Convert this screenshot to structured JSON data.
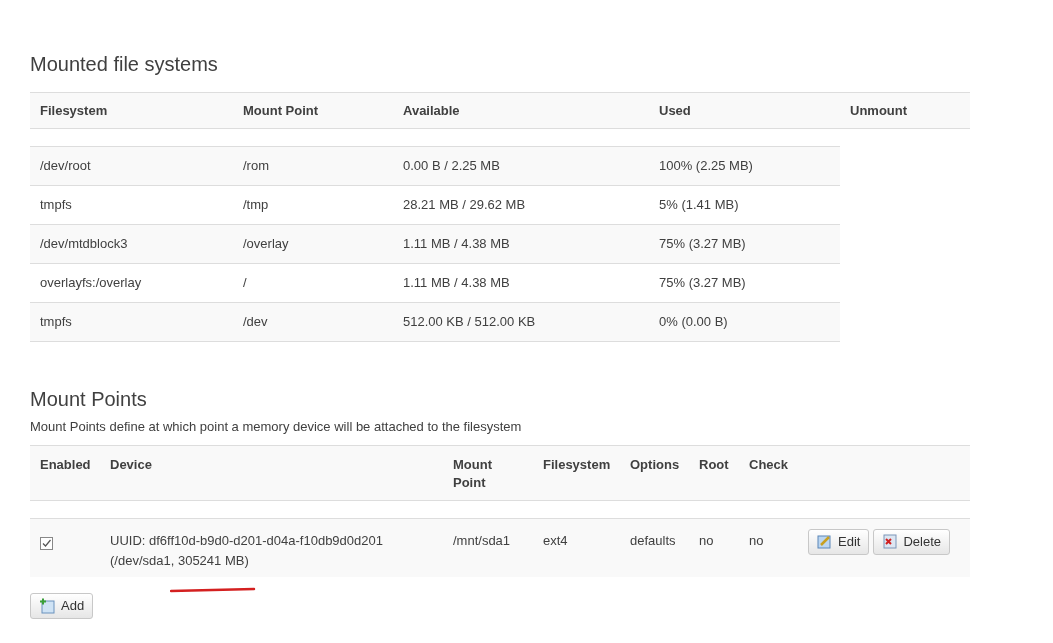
{
  "mounted": {
    "title": "Mounted file systems",
    "columns": [
      "Filesystem",
      "Mount Point",
      "Available",
      "Used",
      "Unmount"
    ],
    "rows": [
      {
        "filesystem": "/dev/root",
        "mount_point": "/rom",
        "available": "0.00 B / 2.25 MB",
        "used": "100% (2.25 MB)"
      },
      {
        "filesystem": "tmpfs",
        "mount_point": "/tmp",
        "available": "28.21 MB / 29.62 MB",
        "used": "5% (1.41 MB)"
      },
      {
        "filesystem": "/dev/mtdblock3",
        "mount_point": "/overlay",
        "available": "1.11 MB / 4.38 MB",
        "used": "75% (3.27 MB)"
      },
      {
        "filesystem": "overlayfs:/overlay",
        "mount_point": "/",
        "available": "1.11 MB / 4.38 MB",
        "used": "75% (3.27 MB)"
      },
      {
        "filesystem": "tmpfs",
        "mount_point": "/dev",
        "available": "512.00 KB / 512.00 KB",
        "used": "0% (0.00 B)"
      }
    ]
  },
  "mount_points": {
    "title": "Mount Points",
    "description": "Mount Points define at which point a memory device will be attached to the filesystem",
    "columns": [
      "Enabled",
      "Device",
      "Mount Point",
      "Filesystem",
      "Options",
      "Root",
      "Check"
    ],
    "rows": [
      {
        "enabled": true,
        "device": "UUID: df6ff10d-b9d0-d201-d04a-f10db9d0d201",
        "device_detail": "(/dev/sda1, 305241 MB)",
        "mount_point": "/mnt/sda1",
        "filesystem": "ext4",
        "options": "defaults",
        "root": "no",
        "check": "no",
        "buttons": [
          "Edit",
          "Delete"
        ]
      }
    ],
    "add_button": "Add"
  }
}
